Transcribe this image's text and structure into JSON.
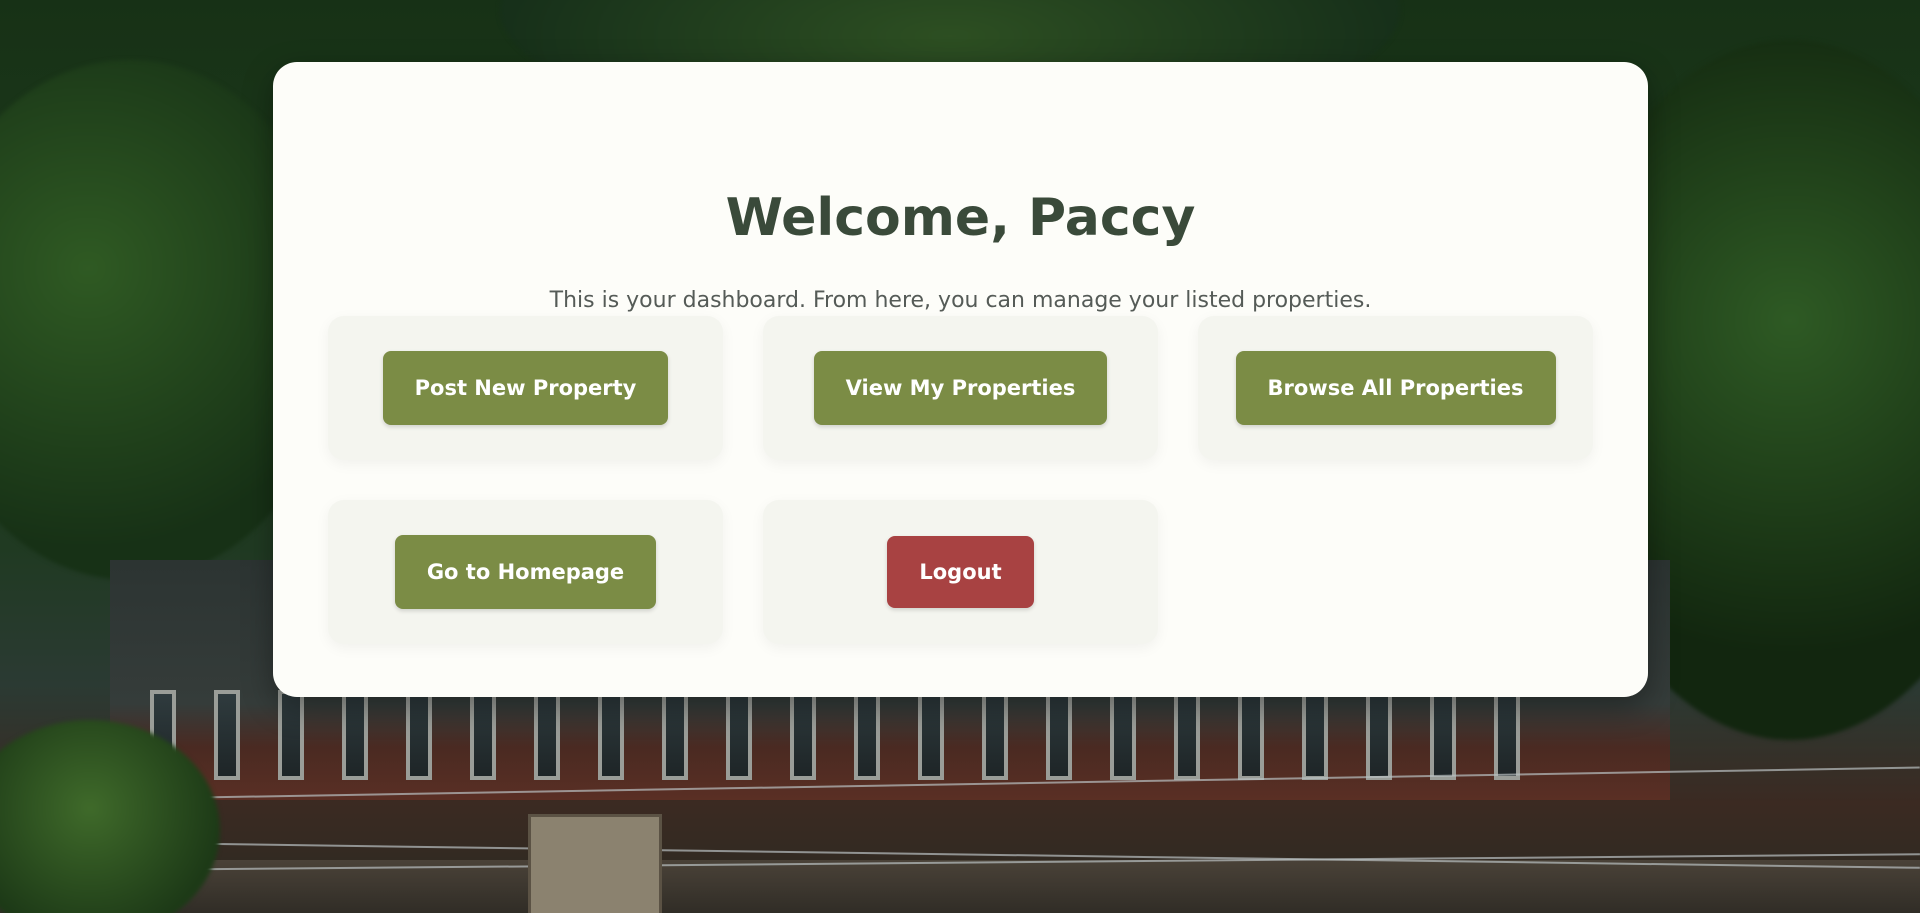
{
  "dashboard": {
    "title": "Welcome, Paccy",
    "subtitle": "This is your dashboard. From here, you can manage your listed properties."
  },
  "actions": {
    "post_new": "Post New Property",
    "view_mine": "View My Properties",
    "browse_all": "Browse All Properties",
    "homepage": "Go to Homepage",
    "logout": "Logout"
  },
  "colors": {
    "primary_button": "#7b8c45",
    "logout_button": "#a84242",
    "card_background": "#fdfdf9",
    "title_text": "#3a4a3a"
  }
}
